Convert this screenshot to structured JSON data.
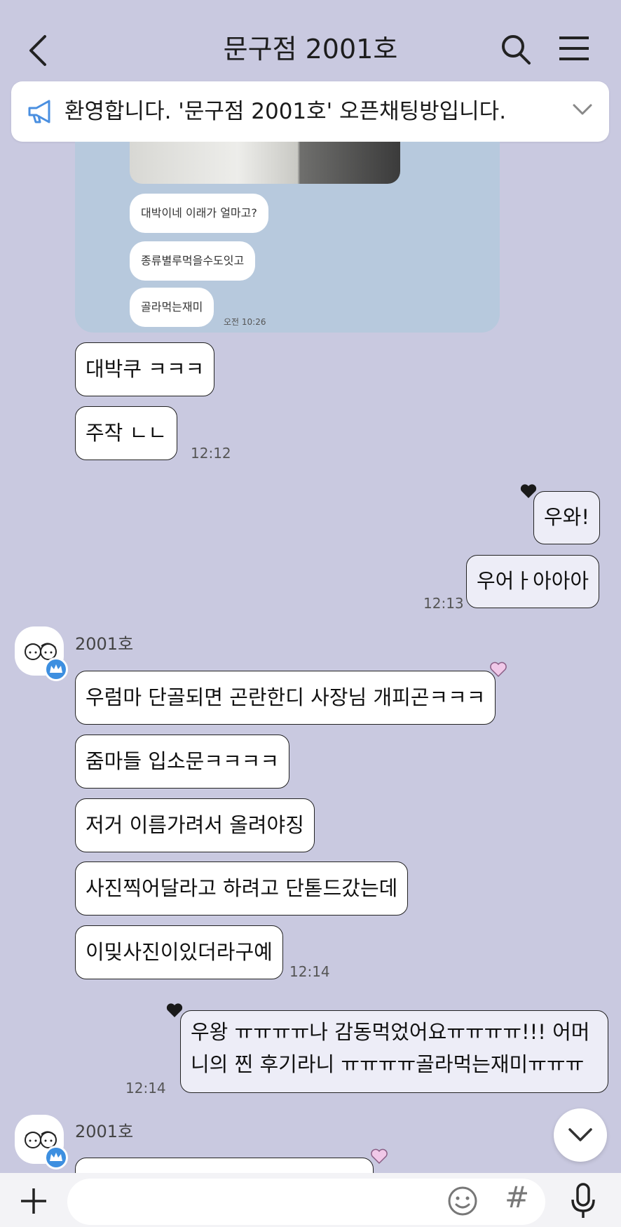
{
  "header": {
    "title": "문구점 2001호",
    "icons": {
      "back": "chevron-left-icon",
      "search": "search-icon",
      "menu": "hamburger-menu-icon"
    }
  },
  "notice": {
    "text": "환영합니다. '문구점 2001호' 오픈채팅방입니다.",
    "icon": "megaphone-icon"
  },
  "photo_message": {
    "bubbles": [
      "대박이네 이래가 얼마고?",
      "종류별루먹을수도잇고",
      "골라먹는재미"
    ],
    "time": "오전 10:26"
  },
  "messages": [
    {
      "id": "m1",
      "side": "left",
      "text": "대박쿠 ㅋㅋㅋ"
    },
    {
      "id": "m2",
      "side": "left",
      "text": "주작 ㄴㄴ",
      "time": "12:12"
    },
    {
      "id": "m3",
      "side": "right",
      "text": "우와!"
    },
    {
      "id": "m4",
      "side": "right",
      "text": "우어ㅏ아아아",
      "time": "12:13"
    },
    {
      "id": "m5",
      "side": "left",
      "sender": "2001호",
      "text": "우럼마 단골되면 곤란한디 사장님 개피곤ㅋㅋㅋ"
    },
    {
      "id": "m6",
      "side": "left",
      "text": "줌마들 입소문ㅋㅋㅋㅋ"
    },
    {
      "id": "m7",
      "side": "left",
      "text": "저거 이름가려서 올려야징"
    },
    {
      "id": "m8",
      "side": "left",
      "text": "사진찍어달라고 하려고 단톧드갔는데"
    },
    {
      "id": "m9",
      "side": "left",
      "text": "이밎사진이있더라구예",
      "time": "12:14"
    },
    {
      "id": "m10",
      "side": "right",
      "text": "우왕 ㅠㅠㅠㅠ나 감동먹었어요ㅠㅠㅠㅠ!!! 어머니의 찐 후기라니 ㅠㅠㅠㅠ골라먹는재미ㅠㅠㅠ",
      "time": "12:14"
    },
    {
      "id": "m11",
      "side": "left",
      "sender": "2001호",
      "text": ""
    }
  ],
  "input": {
    "placeholder": "",
    "value": ""
  },
  "colors": {
    "background": "#c9c9e0",
    "my_bubble": "#ededf7",
    "their_bubble": "#ffffff",
    "crown_badge": "#3d8fe0",
    "heart_dark": "#1a1a1a",
    "heart_pink": "#f0c8e8"
  }
}
